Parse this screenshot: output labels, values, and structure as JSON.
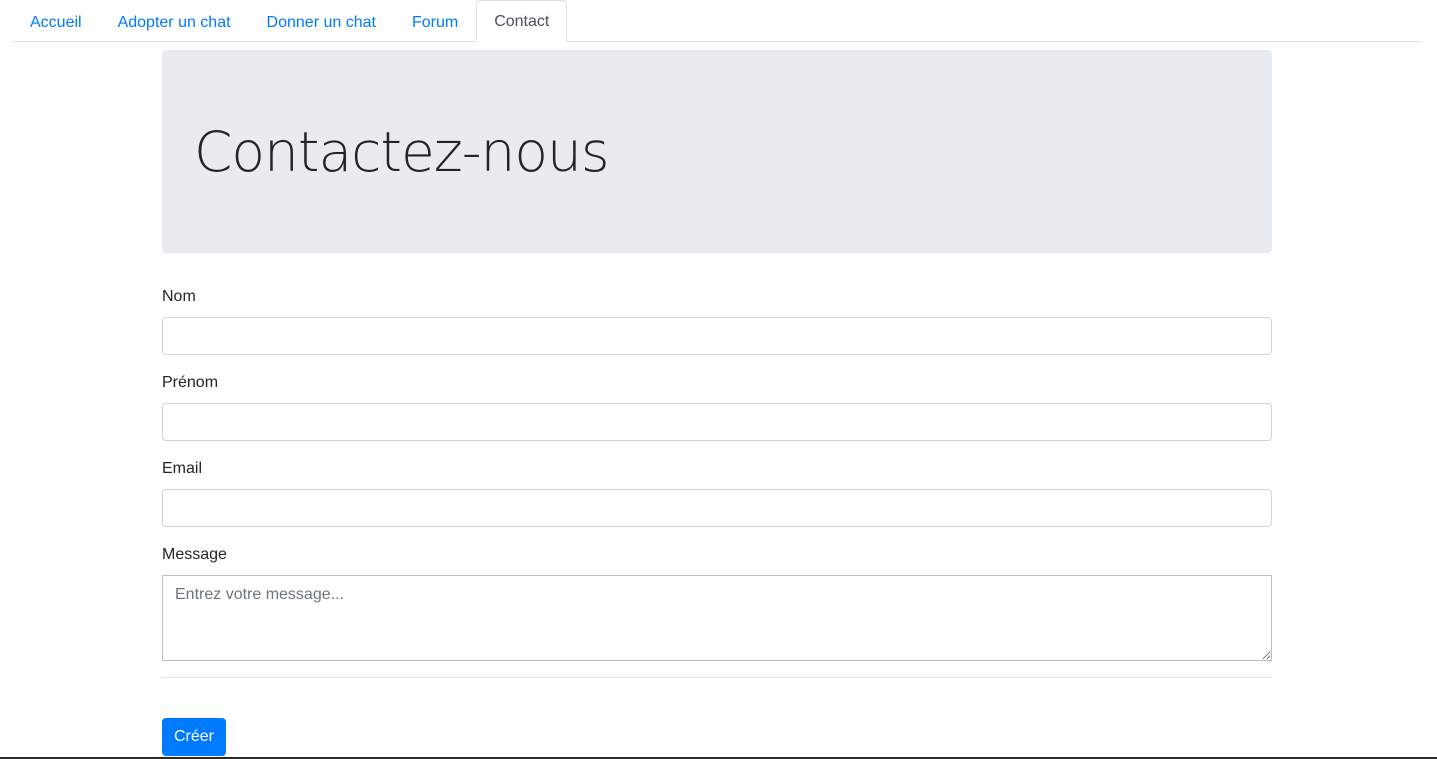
{
  "nav": {
    "tabs": [
      {
        "label": "Accueil",
        "active": false
      },
      {
        "label": "Adopter un chat",
        "active": false
      },
      {
        "label": "Donner un chat",
        "active": false
      },
      {
        "label": "Forum",
        "active": false
      },
      {
        "label": "Contact",
        "active": true
      }
    ]
  },
  "hero": {
    "title": "Contactez-nous"
  },
  "form": {
    "nom_label": "Nom",
    "nom_value": "",
    "prenom_label": "Prénom",
    "prenom_value": "",
    "email_label": "Email",
    "email_value": "",
    "message_label": "Message",
    "message_placeholder": "Entrez votre message...",
    "submit_label": "Créer"
  },
  "colors": {
    "primary": "#007bff",
    "jumbotron_bg": "#e9ecef",
    "border": "#ced4da"
  }
}
